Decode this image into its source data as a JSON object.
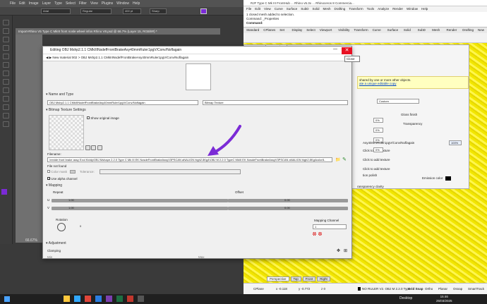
{
  "photoshop": {
    "menu": [
      "File",
      "Edit",
      "Image",
      "Layer",
      "Type",
      "Select",
      "Filter",
      "View",
      "Plugins",
      "Window",
      "Help"
    ],
    "font_family": "Arial",
    "font_style": "Regular",
    "font_size": "400 pt",
    "antialias": "Sharp",
    "doc_tab": "Import-Rhino V5 Type C MkIII front nosle wheel infos Rhino V8.psd @ 66.7% (Layer 15, RGB/8#) *",
    "zoom": "66.67%"
  },
  "rhino": {
    "title": "RJF Type C Mk III FrontHub ... Rhino v5.3x ... Rhinoceros 8 Commercia...",
    "menu": [
      "File",
      "Edit",
      "View",
      "Curve",
      "Surface",
      "SubD",
      "Solid",
      "Mesh",
      "Drafting",
      "Transform",
      "Tools",
      "Analyze",
      "Render",
      "Window",
      "Help"
    ],
    "cmd_lines": [
      "1 closed mesh added to selection.",
      "Command: _Properties",
      "Command:"
    ],
    "tabs": [
      "Standard",
      "CPlanes",
      "Set View",
      "Display",
      "Select",
      "Viewport Layout",
      "Visibility",
      "Transform",
      "Curve Tools",
      "Surface Tools",
      "Solid Tools",
      "SubD Tools",
      "Mesh Tools",
      "Render Tools",
      "Drafting",
      "New in V8"
    ],
    "viewport_tabs": [
      "Perspective",
      "Top",
      "Front",
      "Right"
    ],
    "status": {
      "cplane": "CPlane",
      "x": "x -0.118",
      "y": "y -0.772",
      "z": "z 0",
      "layer": "NO RULER V2. OBJ M 2.2.0 Type",
      "grid_snap": "Grid Snap",
      "ortho": "Ortho",
      "planar": "Planar",
      "osnap": "Osnap",
      "smarttrack": "SmartTrack",
      "gumball": "Gumball",
      "units": "Millimeters",
      "desktop": "Desktop"
    },
    "panel": {
      "tab": "Properties",
      "shared_text": "shared by one or more other objects.",
      "unique_link": "ate a unique editable copy",
      "custom": "Custom",
      "gloss": "Gloss finish",
      "transparency": "Transparency",
      "pct1": "0%",
      "pct2": "0%",
      "pct3": "0%",
      "pct4": "0%",
      "texture_name": "Asy40mmRuler1pgV/Conv/Noflagain",
      "texture_pct": "100%",
      "click_add_1": "Click to add texture",
      "click_add_2": "Click to add texture",
      "click_add_3": "Click to add texture",
      "emission": "Emission color",
      "polish": "tion polish",
      "clarity": "ransparency clarity"
    }
  },
  "dialog": {
    "title": "Editing OBJ Mshp2.1.1 CMkIIINsdefFrontBrakeAsy40mmRuler1pgV/Conv/Noflagain",
    "breadcrumb": "New material 002 > OBJ Mshp2.1.1 CMkIIINsdefFrontBrakeAsy40mmRuler1pgV/Conv/Noflagain",
    "section_name_type": "Name and Type",
    "name_value": "OBJ Mshp2.1.1 CMkIIINsdefFrontBrakeAsy40mmRuler1pgV/Conv/Noflagain",
    "type_value": "Bitmap Texture",
    "section_settings": "Bitmap Texture Settings",
    "show_original": "Show original image",
    "filename_label": "Filename:",
    "filename_value": "\\renide front brake assy Exol Kiddy\\OBJ Mshape 2.2.0 Type C Mk III EK NosdeFrontBrakeAssyV3PSCAN aNALIGN high2.8Kg4\\OBJ M 2.2.0 TypeC MkIII EK NosdeFrontBrakeAssyV3PSCAN aNALIGN high2.8Kg4color8..",
    "file_not_found": "File not found",
    "color_mask": "Color mask",
    "tolerance": "Tolerance:",
    "use_alpha": "Use alpha channel",
    "section_mapping": "Mapping",
    "repeat": "Repeat",
    "offset": "Offset",
    "u_label": "U",
    "v_label": "V",
    "repeat_u": "1.00",
    "repeat_v": "1.00",
    "offset_u": "0.00",
    "offset_v": "0.00",
    "rotation": "Rotation",
    "rotation_value": "0",
    "mapping_channel_label": "Mapping Channel",
    "mapping_channel_value": "1",
    "section_adjustment": "Adjustment",
    "clamping": "Clamping",
    "min": "Min",
    "max": "Max"
  },
  "tooltip": "Close",
  "taskbar": {
    "time": "15:46",
    "date": "25/03/2025"
  },
  "colors": {
    "arrow": "#7b2bd6",
    "close": "#e81123",
    "viewport": "#f2e600"
  }
}
